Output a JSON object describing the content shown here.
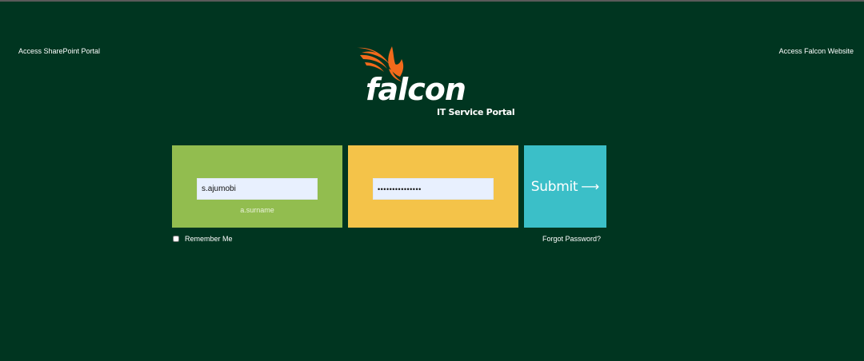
{
  "header": {
    "left_link": "Access SharePoint Portal",
    "right_link": "Access Falcon Website"
  },
  "logo": {
    "wordmark": "falcon",
    "subtitle": "IT Service Portal",
    "bird_icon": "falcon-bird-icon",
    "bird_color": "#f26a1b"
  },
  "login": {
    "username_value": "s.ajumobi",
    "username_hint": "a.surname",
    "password_value": "•••••••••••••••",
    "submit_label": "Submit",
    "submit_arrow": "⟶",
    "remember_label": "Remember Me",
    "forgot_label": "Forgot Password?"
  },
  "colors": {
    "background": "#003520",
    "user_tile": "#92bd4f",
    "password_tile": "#f4c349",
    "submit_tile": "#3bbfc8"
  }
}
